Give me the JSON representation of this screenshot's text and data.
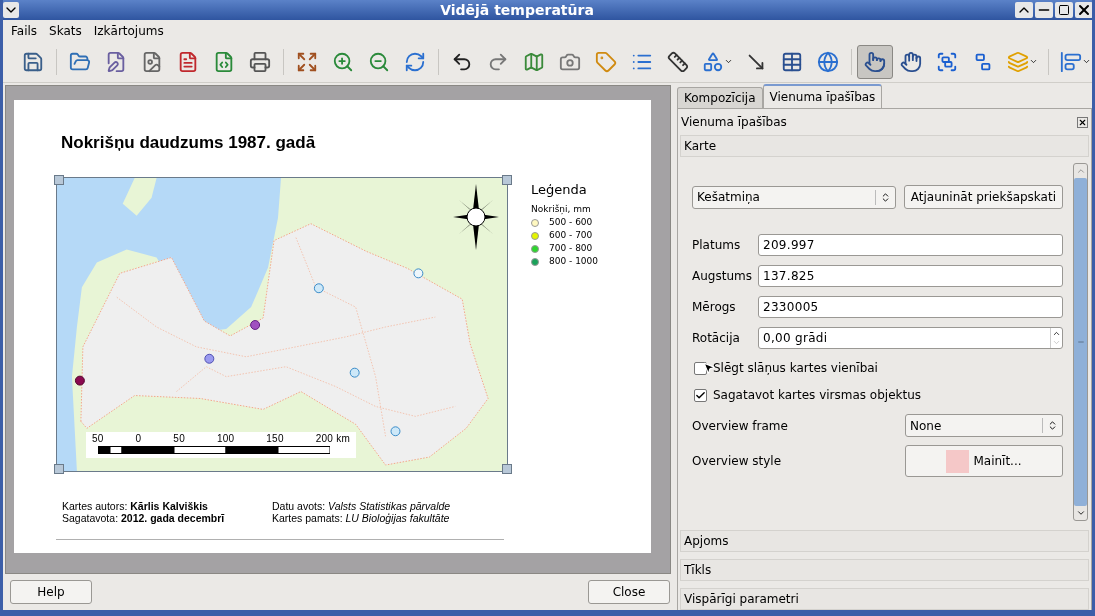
{
  "window": {
    "title": "Vidējā temperatūra"
  },
  "menu": [
    "Fails",
    "Skats",
    "Izkārtojums"
  ],
  "toolbar": {
    "groups": [
      [
        {
          "selected": false
        }
      ],
      [
        {
          "selected": false
        },
        {
          "selected": false
        },
        {
          "selected": false
        },
        {
          "selected": false
        },
        {
          "selected": false
        },
        {
          "selected": false
        }
      ],
      [
        {
          "selected": false
        },
        {
          "selected": false
        },
        {
          "selected": false
        },
        {
          "selected": false
        }
      ],
      [
        {
          "selected": false
        },
        {
          "selected": false
        },
        {
          "selected": false
        },
        {
          "selected": false
        },
        {
          "selected": false
        },
        {
          "selected": false
        },
        {
          "selected": false
        },
        {
          "selected": false
        },
        {
          "selected": false
        },
        {
          "selected": false
        },
        {
          "selected": false
        }
      ],
      [
        {
          "selected": true
        },
        {
          "selected": false
        },
        {
          "selected": false
        },
        {
          "selected": false
        },
        {
          "selected": false
        }
      ],
      [
        {
          "selected": false
        }
      ]
    ]
  },
  "composition": {
    "title": "Nokrišņu daudzums 1987. gadā",
    "scale_bar": [
      "50",
      "0",
      "50",
      "100",
      "150",
      "200 km"
    ],
    "legend": {
      "title": "Leģenda",
      "subtitle": "Nokrišņi, mm",
      "items": [
        {
          "label": "500 - 600",
          "color": "#fff8c0"
        },
        {
          "label": "600 - 700",
          "color": "#e4f500"
        },
        {
          "label": "700 - 800",
          "color": "#2ed62e"
        },
        {
          "label": "800 - 1000",
          "color": "#1aa25a"
        }
      ]
    },
    "footer": {
      "left": [
        "Kartes autors: **Kārlis Kalviškis**",
        "Sagatavota: **2012. gada decembrī**"
      ],
      "right": [
        "Datu avots: *Valsts Statistikas pārvalde*",
        "Kartes pamats: *LU Bioloģijas fakultāte*"
      ]
    }
  },
  "panel": {
    "tabs": [
      {
        "label": "Kompozīcija",
        "selected": false
      },
      {
        "label": "Vienuma īpašības",
        "selected": true
      }
    ],
    "dock_title": "Vienuma īpašības",
    "sections": [
      {
        "label": "Karte"
      },
      {
        "label": "Apjoms"
      },
      {
        "label": "Tīkls"
      },
      {
        "label": "Vispārīgi parametri"
      }
    ],
    "map_settings": {
      "preview": "Kešatmiņa",
      "update_button": "Atjaunināt priekšapskati",
      "fields": [
        {
          "label": "Platums",
          "value": "209.997",
          "kind": "text"
        },
        {
          "label": "Augstums",
          "value": "137.825",
          "kind": "text"
        },
        {
          "label": "Mērogs",
          "value": "2330005",
          "kind": "text"
        },
        {
          "label": "Rotācija",
          "value": "0,00 grādi",
          "kind": "spin"
        }
      ],
      "checkboxes": [
        {
          "label": "Slēgt slāņus kartes vienībai",
          "checked": false
        },
        {
          "label": "Sagatavot kartes virsmas objektus",
          "checked": true
        }
      ],
      "overview_frame": {
        "label": "Overview frame",
        "value": "None"
      },
      "overview_style": {
        "label": "Overview style",
        "button": "Mainīt..."
      }
    }
  },
  "buttons": {
    "help": "Help",
    "close": "Close"
  }
}
